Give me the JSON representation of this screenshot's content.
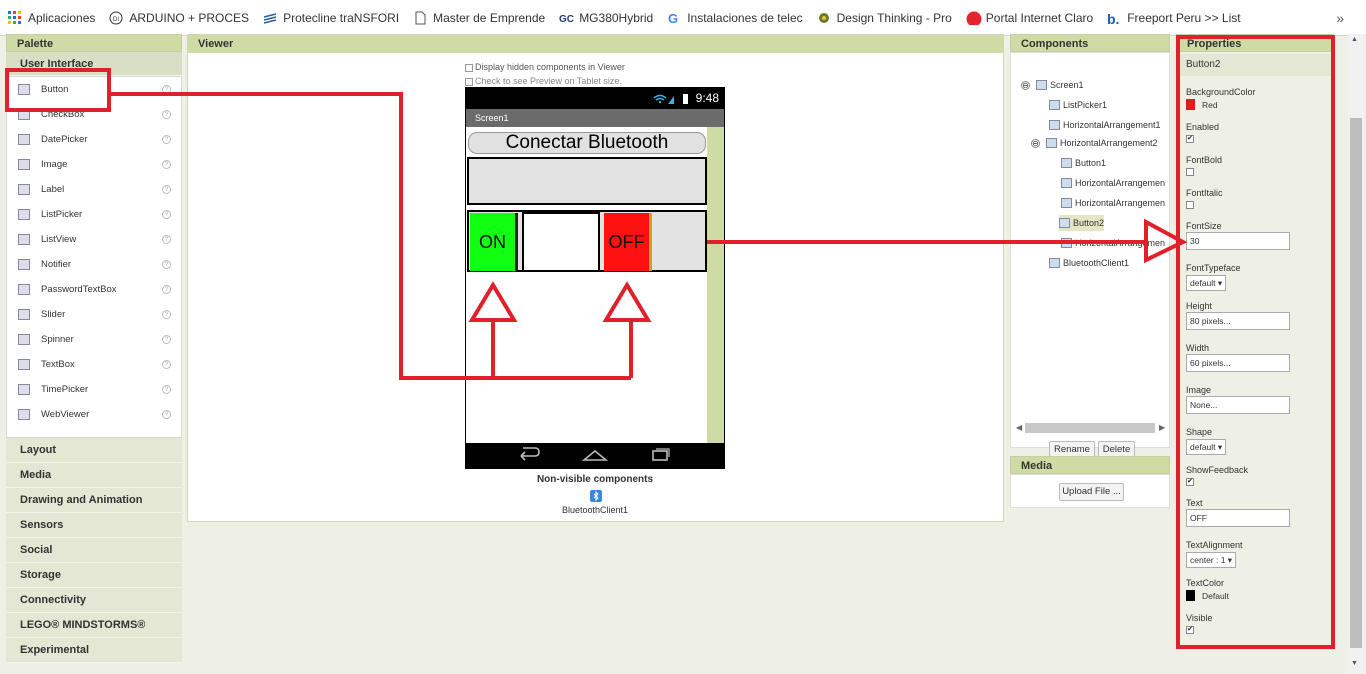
{
  "bookmarks": {
    "items": [
      {
        "label": "Aplicaciones",
        "icon": "apps-grid-icon"
      },
      {
        "label": "ARDUINO + PROCES",
        "icon": "di-logo-icon"
      },
      {
        "label": "Protecline traNSFORI",
        "icon": "protecline-logo-icon"
      },
      {
        "label": "Master de Emprende",
        "icon": "document-icon"
      },
      {
        "label": "MG380Hybrid",
        "icon": "gc-logo-icon"
      },
      {
        "label": "Instalaciones de telec",
        "icon": "google-logo-icon"
      },
      {
        "label": "Design Thinking - Pro",
        "icon": "design-thinking-icon"
      },
      {
        "label": "Portal Internet Claro",
        "icon": "claro-logo-icon"
      },
      {
        "label": "Freeport Peru >> List",
        "icon": "booking-logo-icon"
      }
    ],
    "more": "»"
  },
  "palette": {
    "title": "Palette",
    "open_category": "User Interface",
    "items": [
      {
        "label": "Button",
        "icon": "button-icon"
      },
      {
        "label": "CheckBox",
        "icon": "checkbox-icon"
      },
      {
        "label": "DatePicker",
        "icon": "datepicker-icon"
      },
      {
        "label": "Image",
        "icon": "image-icon"
      },
      {
        "label": "Label",
        "icon": "label-icon"
      },
      {
        "label": "ListPicker",
        "icon": "listpicker-icon"
      },
      {
        "label": "ListView",
        "icon": "listview-icon"
      },
      {
        "label": "Notifier",
        "icon": "notifier-icon"
      },
      {
        "label": "PasswordTextBox",
        "icon": "password-icon"
      },
      {
        "label": "Slider",
        "icon": "slider-icon"
      },
      {
        "label": "Spinner",
        "icon": "spinner-icon"
      },
      {
        "label": "TextBox",
        "icon": "textbox-icon"
      },
      {
        "label": "TimePicker",
        "icon": "timepicker-icon"
      },
      {
        "label": "WebViewer",
        "icon": "webviewer-icon"
      }
    ],
    "help_glyph": "?",
    "categories": [
      "Layout",
      "Media",
      "Drawing and Animation",
      "Sensors",
      "Social",
      "Storage",
      "Connectivity",
      "LEGO® MINDSTORMS®",
      "Experimental"
    ]
  },
  "viewer": {
    "title": "Viewer",
    "display_hidden": "Display hidden components in Viewer",
    "tablet_preview": "Check to see Preview on Tablet size.",
    "phone": {
      "time": "9:48",
      "screen_title": "Screen1",
      "connect_button": "Conectar Bluetooth",
      "on_button": "ON",
      "off_button": "OFF",
      "on_color": "#11ff11",
      "off_color": "#ff1111"
    },
    "nonvisible_title": "Non-visible components",
    "nonvisible_item": "BluetoothClient1"
  },
  "components": {
    "title": "Components",
    "tree": [
      {
        "label": "Screen1",
        "toggle": "⊖"
      },
      {
        "label": "ListPicker1"
      },
      {
        "label": "HorizontalArrangement1"
      },
      {
        "label": "HorizontalArrangement2",
        "toggle": "⊖"
      },
      {
        "label": "Button1"
      },
      {
        "label": "HorizontalArrangemen"
      },
      {
        "label": "HorizontalArrangemen"
      },
      {
        "label": "Button2"
      },
      {
        "label": "HorizontalArrangemen"
      },
      {
        "label": "BluetoothClient1"
      }
    ],
    "rename_button": "Rename",
    "delete_button": "Delete"
  },
  "media": {
    "title": "Media",
    "upload_button": "Upload File ..."
  },
  "properties": {
    "title": "Properties",
    "component": "Button2",
    "background_color_label": "BackgroundColor",
    "background_color_value": "Red",
    "background_color_hex": "#e31b1b",
    "enabled_label": "Enabled",
    "font_bold_label": "FontBold",
    "font_italic_label": "FontItalic",
    "font_size_label": "FontSize",
    "font_size_value": "30",
    "font_typeface_label": "FontTypeface",
    "font_typeface_value": "default ▾",
    "height_label": "Height",
    "height_value": "80 pixels...",
    "width_label": "Width",
    "width_value": "60 pixels...",
    "image_label": "Image",
    "image_value": "None...",
    "shape_label": "Shape",
    "shape_value": "default ▾",
    "show_feedback_label": "ShowFeedback",
    "text_label": "Text",
    "text_value": "OFF",
    "text_alignment_label": "TextAlignment",
    "text_alignment_value": "center : 1 ▾",
    "text_color_label": "TextColor",
    "text_color_value": "Default",
    "text_color_hex": "#000000",
    "visible_label": "Visible",
    "check_glyph": "✔"
  },
  "annotation_color": "#e0202a"
}
